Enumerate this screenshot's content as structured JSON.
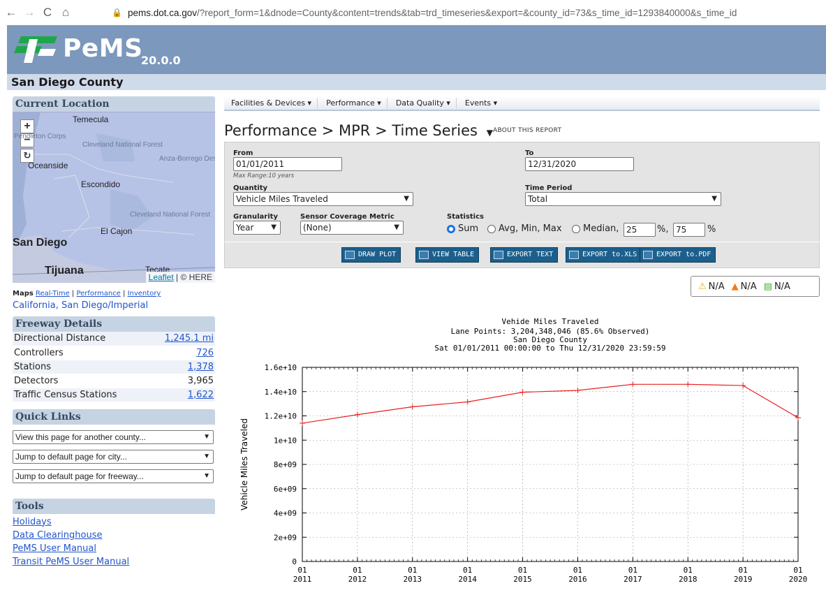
{
  "browser": {
    "domain": "pems.dot.ca.gov",
    "path": "/?report_form=1&dnode=County&content=trends&tab=trd_timeseries&export=&county_id=73&s_time_id=1293840000&s_time_id"
  },
  "header": {
    "logo_text": "PeMS",
    "version": "20.0.0",
    "county": "San Diego County"
  },
  "sidebar": {
    "current_location_title": "Current Location",
    "map": {
      "labels": {
        "temecula": "Temecula",
        "oceanside": "Oceanside",
        "escondido": "Escondido",
        "el_cajon": "El Cajon",
        "san_diego": "San Diego",
        "tijuana": "Tijuana",
        "tecate": "Tecate",
        "cleveland1": "Cleveland National Forest",
        "anza": "Anza-Borrego Desert State Park",
        "cleveland2": "Cleveland National Forest",
        "pendleton": "Pendleton Corps"
      },
      "attrib_link": "Leaflet",
      "attrib_text": " | © HERE"
    },
    "maps_label": "Maps",
    "maps_links": [
      "Real-Time",
      "Performance",
      "Inventory"
    ],
    "location_path": "California, San Diego/Imperial",
    "freeway_details_title": "Freeway Details",
    "freeway_details": [
      {
        "label": "Directional Distance",
        "value": "1,245.1 mi",
        "link": true
      },
      {
        "label": "Controllers",
        "value": "726",
        "link": true
      },
      {
        "label": "Stations",
        "value": "1,378",
        "link": true
      },
      {
        "label": "Detectors",
        "value": "3,965",
        "link": false
      },
      {
        "label": "Traffic Census Stations",
        "value": "1,622",
        "link": true
      }
    ],
    "quick_links_title": "Quick Links",
    "quick_links": [
      "View this page for another county...",
      "Jump to default page for city...",
      "Jump to default page for freeway..."
    ],
    "tools_title": "Tools",
    "tools": [
      "Holidays",
      "Data Clearinghouse",
      "PeMS User Manual",
      "Transit PeMS User Manual"
    ]
  },
  "menu": [
    "Facilities & Devices ▾",
    "Performance ▾",
    "Data Quality ▾",
    "Events ▾"
  ],
  "breadcrumb": "Performance > MPR > Time Series",
  "about": "ABOUT THIS REPORT",
  "form": {
    "from_label": "From",
    "from_value": "01/01/2011",
    "max_range": "Max Range:10 years",
    "to_label": "To",
    "to_value": "12/31/2020",
    "quantity_label": "Quantity",
    "quantity_value": "Vehicle Miles Traveled",
    "time_period_label": "Time Period",
    "time_period_value": "Total",
    "granularity_label": "Granularity",
    "granularity_value": "Year",
    "sensor_label": "Sensor Coverage Metric",
    "sensor_value": "(None)",
    "statistics_label": "Statistics",
    "stat_sum": "Sum",
    "stat_avg": "Avg, Min, Max",
    "stat_median": "Median,",
    "pct1": "25",
    "pct_sep": "%,",
    "pct2": "75",
    "pct_end": "%",
    "buttons": [
      "DRAW PLOT",
      "VIEW TABLE",
      "EXPORT TEXT",
      "EXPORT to.XLS",
      "EXPORT to.PDF"
    ]
  },
  "stats_badges": [
    "N/A",
    "N/A",
    "N/A"
  ],
  "chart_data": {
    "type": "line",
    "title": "Vehide Miles Traveled",
    "subtitle_lines": [
      "Lane Points: 3,204,348,046 (85.6% Observed)",
      "San Diego County",
      "Sat 01/01/2011 00:00:00 to Thu 12/31/2020 23:59:59"
    ],
    "ylabel": "Vehicle Miles Traveled",
    "xlabel": "",
    "ylim": [
      0,
      16000000000
    ],
    "y_ticks": [
      "0",
      "2e+09",
      "4e+09",
      "6e+09",
      "8e+09",
      "1e+10",
      "1.2e+10",
      "1.4e+10",
      "1.6e+10"
    ],
    "x_ticks_top": [
      "01",
      "01",
      "01",
      "01",
      "01",
      "01",
      "01",
      "01",
      "01",
      "01"
    ],
    "x_ticks_bottom": [
      "2011",
      "2012",
      "2013",
      "2014",
      "2015",
      "2016",
      "2017",
      "2018",
      "2019",
      "2020"
    ],
    "grid": true,
    "color": "#e8201e",
    "x": [
      "2011",
      "2012",
      "2013",
      "2014",
      "2015",
      "2016",
      "2017",
      "2018",
      "2019",
      "2020"
    ],
    "values": [
      11400000000,
      12100000000,
      12750000000,
      13150000000,
      13950000000,
      14100000000,
      14600000000,
      14600000000,
      14500000000,
      11850000000
    ]
  }
}
